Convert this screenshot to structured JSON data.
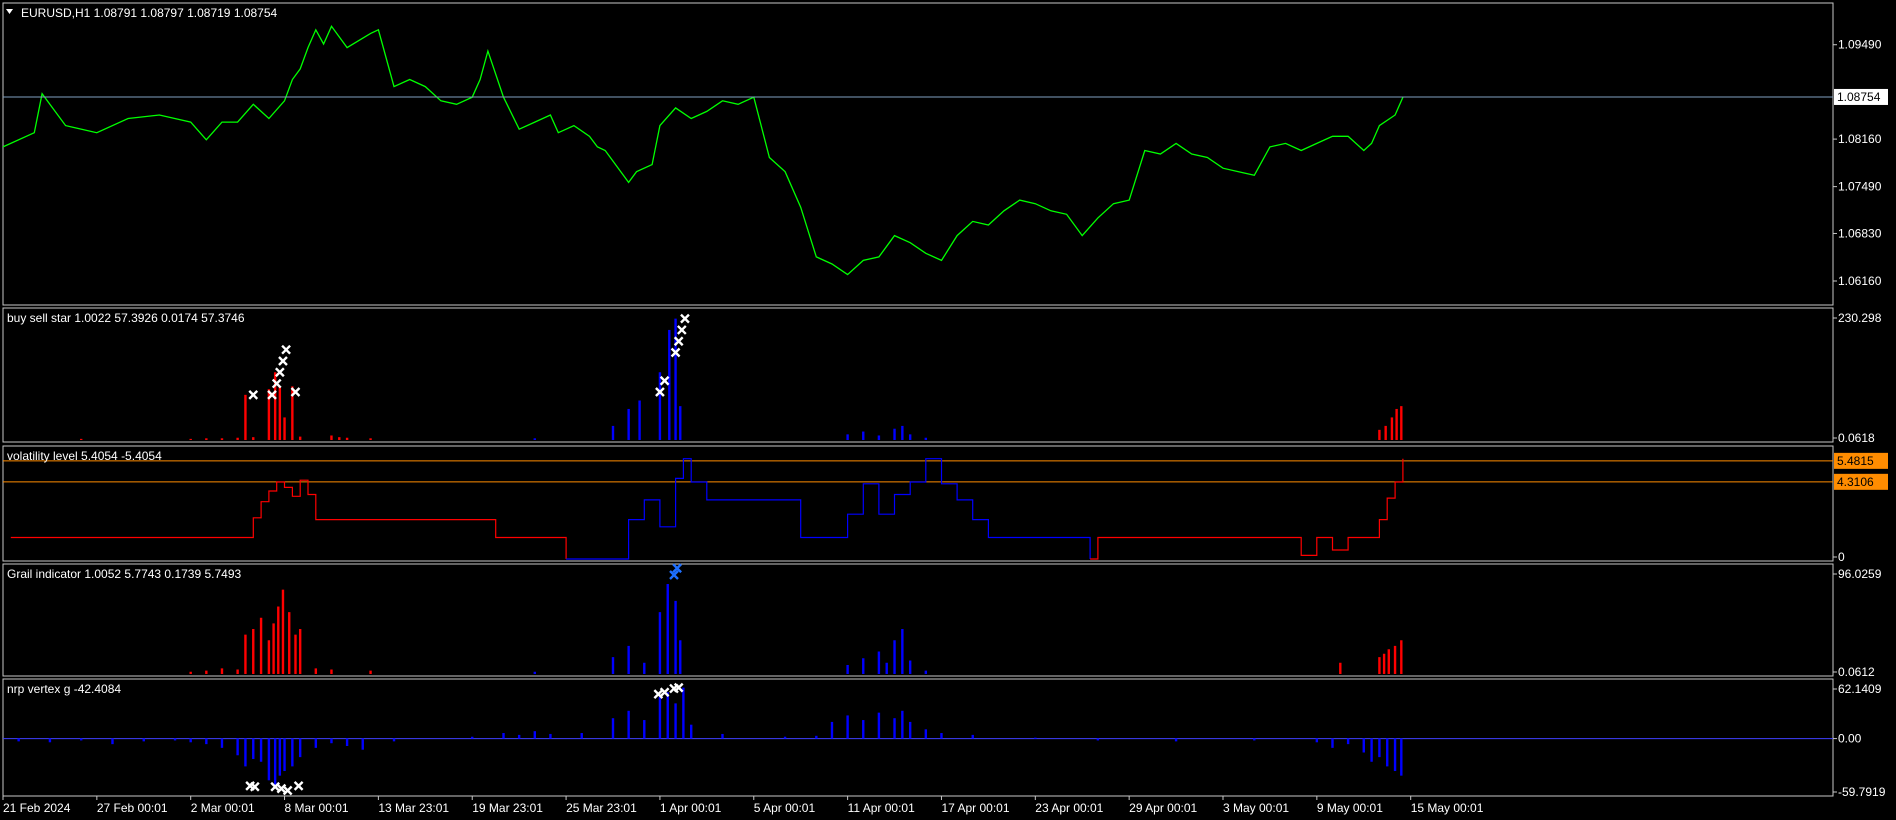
{
  "chart_data": [
    {
      "type": "line",
      "title": "EURUSD,H1  1.08791 1.08797 1.08719 1.08754",
      "ylim": [
        1.0585,
        1.1005
      ],
      "y_ticks": [
        "1.09490",
        "1.08160",
        "1.07490",
        "1.06830",
        "1.06160"
      ],
      "current_price": "1.08754",
      "colors": {
        "line": "#00ff00",
        "price_line": "#7f9fbf"
      },
      "series": [
        {
          "x": [
            0.0,
            2.0,
            2.5,
            4.0,
            6.0,
            8.0,
            10.0,
            12.0,
            13.0,
            14.0,
            15.0,
            16.0,
            17.0,
            18.0,
            18.5,
            19.0,
            19.5,
            20.0,
            20.5,
            21.0,
            22.0,
            23.5,
            24.0,
            25.0,
            26.0,
            27.0,
            28.0,
            29.0,
            30.0,
            30.5,
            31.0,
            32.0,
            33.0,
            34.0,
            35.0,
            35.5,
            36.0,
            36.5,
            37.5,
            38.0,
            38.5,
            39.0,
            40.0,
            40.5,
            41.5,
            42.0,
            43.0,
            44.0,
            45.0,
            46.0,
            47.0,
            48.0,
            49.0,
            50.0,
            51.0,
            52.0,
            53.0,
            54.0,
            55.0,
            56.0,
            57.0,
            58.0,
            59.0,
            60.0,
            61.0,
            62.0,
            63.0,
            64.0,
            65.0,
            66.0,
            67.0,
            68.0,
            69.0,
            70.0,
            71.0,
            72.0,
            73.0,
            74.0,
            75.0,
            76.0,
            77.0,
            78.0,
            79.0,
            80.0,
            81.0,
            82.0,
            83.0,
            84.0,
            85.0,
            86.0,
            87.0,
            87.5,
            88.0,
            89.0,
            89.5
          ],
          "values": [
            1.0805,
            1.0825,
            1.088,
            1.0835,
            1.0825,
            1.0845,
            1.085,
            1.084,
            1.0815,
            1.084,
            1.084,
            1.0865,
            1.0845,
            1.087,
            1.09,
            1.0915,
            1.0945,
            1.097,
            1.095,
            1.0975,
            1.0945,
            1.0965,
            1.097,
            1.089,
            1.09,
            1.089,
            1.087,
            1.0865,
            1.0875,
            1.09,
            1.094,
            1.0875,
            1.083,
            1.084,
            1.085,
            1.0825,
            1.083,
            1.0835,
            1.082,
            1.0805,
            1.08,
            1.0785,
            1.0755,
            1.077,
            1.078,
            1.0835,
            1.086,
            1.0845,
            1.0855,
            1.087,
            1.0865,
            1.0875,
            1.079,
            1.077,
            1.072,
            1.065,
            1.064,
            1.0625,
            1.0645,
            1.065,
            1.068,
            1.067,
            1.0655,
            1.0645,
            1.068,
            1.07,
            1.0695,
            1.0715,
            1.073,
            1.0725,
            1.0715,
            1.071,
            1.068,
            1.0705,
            1.0725,
            1.073,
            1.08,
            1.0795,
            1.081,
            1.0795,
            1.079,
            1.0775,
            1.077,
            1.0765,
            1.0805,
            1.081,
            1.08,
            1.081,
            1.082,
            1.082,
            1.08,
            1.081,
            1.0835,
            1.085,
            1.0875
          ]
        }
      ]
    },
    {
      "type": "bar",
      "title": "buy sell star 1.0022 57.3926 0.0174 57.3746",
      "ylim": [
        0,
        230.298
      ],
      "y_ticks": [
        "230.298",
        "0.0618"
      ],
      "colors": {
        "buy": "#0000ff",
        "sell": "#ff0000",
        "marker": "#ffffff"
      },
      "series": [
        {
          "name": "sell",
          "x": [
            5.0,
            12.0,
            13.0,
            14.0,
            15.0,
            15.5,
            16.0,
            17.0,
            17.4,
            17.7,
            18.0,
            18.5,
            19.0,
            21.0,
            21.5,
            22.0,
            23.5,
            88.0,
            88.4,
            88.8,
            89.1,
            89.4
          ],
          "values": [
            2,
            2,
            3,
            3,
            4,
            80,
            5,
            90,
            120,
            95,
            40,
            95,
            6,
            8,
            5,
            4,
            3,
            18,
            25,
            40,
            55,
            60
          ]
        },
        {
          "name": "buy",
          "x": [
            34.0,
            39.0,
            40.0,
            40.7,
            42.0,
            42.6,
            43.0,
            43.3,
            54.0,
            55.0,
            56.0,
            57.0,
            57.5,
            58.0,
            59.0
          ],
          "values": [
            3,
            25,
            55,
            70,
            120,
            195,
            215,
            60,
            10,
            15,
            8,
            20,
            25,
            10,
            4
          ]
        },
        {
          "name": "marker",
          "x": [
            16.0,
            17.2,
            17.5,
            17.7,
            17.9,
            18.1,
            18.7,
            42.0,
            42.3,
            43.0,
            43.2,
            43.4,
            43.6
          ],
          "values": [
            80,
            80,
            100,
            120,
            140,
            160,
            85,
            85,
            105,
            155,
            175,
            195,
            215
          ]
        }
      ]
    },
    {
      "type": "line",
      "title": "volatility level 5.4054 -5.4054",
      "ylim": [
        0,
        6.2
      ],
      "y_ticks": [
        "0"
      ],
      "level_labels": [
        "5.4815",
        "4.3106"
      ],
      "level_values": [
        5.4815,
        4.3106
      ],
      "colors": {
        "up": "#ff0000",
        "down": "#0000ff",
        "level": "#ff8c00"
      },
      "series": [
        {
          "name": "red",
          "x": [
            0.5,
            15.5,
            16.0,
            16.5,
            17.0,
            17.5,
            18.0,
            18.5,
            19.0,
            19.5,
            20.0,
            31.0,
            31.5,
            34.5,
            36.0
          ],
          "values": [
            1.2,
            1.2,
            2.3,
            3.2,
            3.8,
            4.3,
            4.0,
            3.5,
            4.4,
            3.6,
            2.2,
            2.2,
            1.2,
            1.2,
            0.0
          ]
        },
        {
          "name": "blue",
          "x": [
            36.0,
            39.0,
            40.0,
            41.0,
            42.0,
            43.0,
            43.5,
            44.0,
            45.0,
            49.5,
            51.0,
            53.0,
            54.0,
            55.0,
            56.0,
            57.0,
            58.0,
            59.0,
            60.0,
            61.0,
            62.0,
            63.0,
            64.0,
            69.0,
            69.5
          ],
          "values": [
            0.0,
            0.0,
            2.2,
            3.3,
            1.8,
            4.5,
            5.6,
            4.3,
            3.3,
            3.3,
            1.2,
            1.2,
            2.5,
            4.2,
            2.5,
            3.6,
            4.3,
            5.6,
            4.2,
            3.3,
            2.2,
            1.2,
            1.2,
            1.2,
            0.0
          ]
        },
        {
          "name": "red-tail",
          "x": [
            69.5,
            70.0,
            82.0,
            83.0,
            84.0,
            85.0,
            86.0,
            87.0,
            88.0,
            88.5,
            89.0,
            89.5
          ],
          "values": [
            0.0,
            1.2,
            1.2,
            0.2,
            1.2,
            0.5,
            1.2,
            1.2,
            2.2,
            3.4,
            4.3,
            5.6
          ]
        }
      ]
    },
    {
      "type": "bar",
      "title": "Grail indicator 1.0052 5.7743 0.1739 5.7493",
      "ylim": [
        0,
        96.0259
      ],
      "y_ticks": [
        "96.0259",
        "0.0612"
      ],
      "colors": {
        "buy": "#0000ff",
        "sell": "#ff0000",
        "marker": "#1e6fff"
      },
      "series": [
        {
          "name": "sell",
          "x": [
            12.0,
            13.0,
            14.0,
            15.0,
            15.5,
            16.0,
            16.5,
            17.0,
            17.3,
            17.6,
            17.9,
            18.3,
            18.7,
            19.0,
            20.0,
            21.0,
            23.5,
            85.5,
            88.0,
            88.3,
            88.6,
            89.0,
            89.4
          ],
          "values": [
            2,
            3,
            5,
            4,
            35,
            40,
            50,
            30,
            45,
            60,
            75,
            55,
            35,
            40,
            5,
            4,
            3,
            10,
            15,
            18,
            22,
            25,
            30
          ]
        },
        {
          "name": "buy",
          "x": [
            34.0,
            39.0,
            40.0,
            41.0,
            42.0,
            42.5,
            43.0,
            43.3,
            54.0,
            55.0,
            56.0,
            56.5,
            57.0,
            57.5,
            58.0,
            59.0
          ],
          "values": [
            2,
            15,
            25,
            10,
            55,
            80,
            65,
            30,
            8,
            14,
            20,
            10,
            30,
            40,
            12,
            3
          ]
        },
        {
          "name": "marker",
          "x": [
            42.9,
            43.1
          ],
          "values": [
            88,
            94
          ]
        }
      ]
    },
    {
      "type": "bar",
      "title": "nrp vertex g -42.4084",
      "ylim": [
        -59.7919,
        62.1409
      ],
      "y_ticks": [
        "62.1409",
        "0.00",
        "-59.7919"
      ],
      "colors": {
        "bar": "#0000ff",
        "zero": "#4040ff",
        "marker": "#ffffff"
      },
      "series": [
        {
          "name": "histogram",
          "x": [
            1.0,
            3.0,
            5.0,
            7.0,
            9.0,
            11.0,
            12.0,
            13.0,
            14.0,
            15.0,
            15.5,
            16.0,
            16.5,
            17.0,
            17.4,
            17.7,
            18.0,
            18.5,
            19.0,
            20.0,
            21.0,
            22.0,
            23.0,
            25.0,
            30.0,
            32.0,
            33.0,
            34.0,
            35.0,
            37.0,
            39.0,
            40.0,
            41.0,
            42.0,
            42.5,
            43.0,
            43.5,
            44.0,
            46.0,
            50.0,
            52.0,
            53.0,
            54.0,
            55.0,
            56.0,
            57.0,
            57.5,
            58.0,
            59.0,
            60.0,
            62.0,
            66.0,
            70.0,
            75.0,
            80.0,
            84.0,
            85.0,
            86.0,
            87.0,
            87.5,
            88.0,
            88.5,
            89.0,
            89.4
          ],
          "values": [
            -3,
            -4,
            -2,
            -6,
            -3,
            -2,
            -4,
            -6,
            -10,
            -18,
            -30,
            -22,
            -25,
            -45,
            -50,
            -40,
            -35,
            -30,
            -20,
            -10,
            -5,
            -8,
            -12,
            -3,
            2,
            6,
            4,
            8,
            5,
            6,
            22,
            30,
            20,
            45,
            50,
            38,
            55,
            15,
            5,
            2,
            3,
            18,
            25,
            20,
            28,
            22,
            30,
            18,
            10,
            6,
            4,
            1,
            -2,
            -3,
            -2,
            -4,
            -10,
            -6,
            -15,
            -25,
            -20,
            -30,
            -35,
            -40
          ]
        },
        {
          "name": "marker",
          "x": [
            15.8,
            16.1,
            17.4,
            17.8,
            18.2,
            18.9,
            41.9,
            42.3,
            42.9,
            43.2
          ],
          "values": [
            -51,
            -52,
            -52,
            -54,
            -56,
            -51,
            48,
            50,
            54,
            55
          ]
        }
      ]
    }
  ],
  "x_axis": {
    "labels": [
      "21 Feb 2024",
      "27 Feb 00:01",
      "2 Mar 00:01",
      "8 Mar 00:01",
      "13 Mar 23:01",
      "19 Mar 23:01",
      "25 Mar 23:01",
      "1 Apr 00:01",
      "5 Apr 00:01",
      "11 Apr 00:01",
      "17 Apr 00:01",
      "23 Apr 00:01",
      "29 Apr 00:01",
      "3 May 00:01",
      "9 May 00:01",
      "15 May 00:01"
    ],
    "positions": [
      0,
      6,
      12,
      18,
      24,
      30,
      36,
      42,
      48,
      54,
      60,
      66,
      72,
      78,
      84,
      90
    ],
    "range": [
      0,
      117
    ]
  }
}
